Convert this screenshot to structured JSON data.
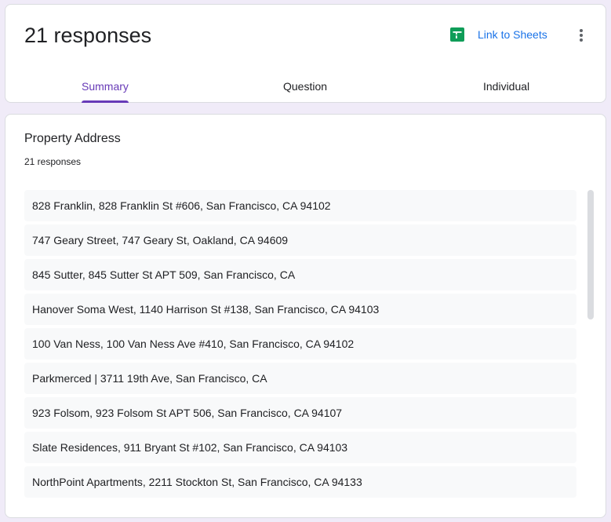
{
  "header": {
    "title": "21 responses",
    "link_label": "Link to Sheets",
    "sheets_icon": "sheets-icon",
    "more_icon": "more-vert-icon"
  },
  "tabs": [
    {
      "label": "Summary",
      "active": true
    },
    {
      "label": "Question",
      "active": false
    },
    {
      "label": "Individual",
      "active": false
    }
  ],
  "question": {
    "title": "Property Address",
    "count": "21 responses",
    "answers": [
      "828 Franklin, 828 Franklin St #606, San Francisco, CA 94102",
      "747 Geary Street, 747 Geary St, Oakland, CA 94609",
      "845 Sutter, 845 Sutter St APT 509, San Francisco, CA",
      "Hanover Soma West, 1140 Harrison St #138, San Francisco, CA 94103",
      "100 Van Ness, 100 Van Ness Ave #410, San Francisco, CA 94102",
      "Parkmerced | 3711 19th Ave, San Francisco, CA",
      "923 Folsom, 923 Folsom St APT 506, San Francisco, CA 94107",
      "Slate Residences, 911 Bryant St #102, San Francisco, CA 94103",
      "NorthPoint Apartments, 2211 Stockton St, San Francisco, CA 94133"
    ]
  },
  "colors": {
    "background": "#f0ebf8",
    "accent": "#673ab7",
    "link": "#1a73e8",
    "sheets_green": "#0f9d58"
  }
}
